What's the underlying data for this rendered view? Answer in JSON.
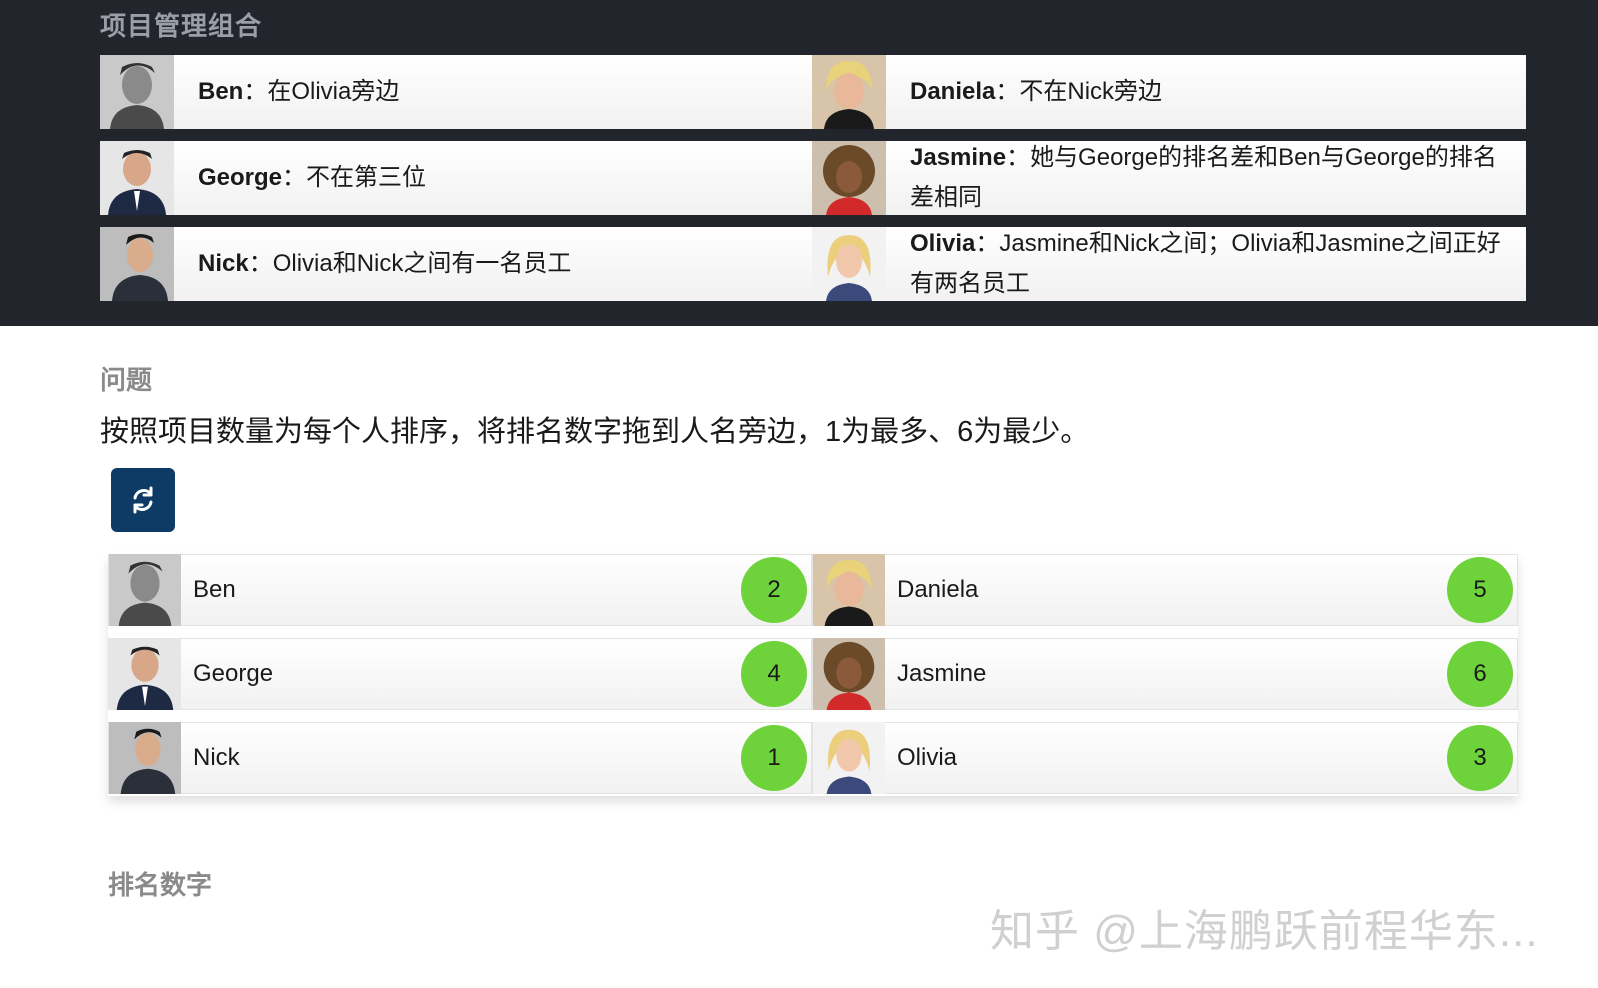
{
  "header": {
    "title": "项目管理组合"
  },
  "colors": {
    "dark_band": "#22252b",
    "badge": "#6ed33a",
    "reset_button": "#0e3b66"
  },
  "clues": [
    {
      "name": "Ben",
      "sep": "：",
      "text": "在Olivia旁边",
      "avatar_icon": "person-photo"
    },
    {
      "name": "Daniela",
      "sep": "：",
      "text": "不在Nick旁边",
      "avatar_icon": "person-photo"
    },
    {
      "name": "George",
      "sep": "：",
      "text": "不在第三位",
      "avatar_icon": "person-photo"
    },
    {
      "name": "Jasmine",
      "sep": "：",
      "text": "她与George的排名差和Ben与George的排名差相同",
      "avatar_icon": "person-photo"
    },
    {
      "name": "Nick",
      "sep": "：",
      "text": "Olivia和Nick之间有一名员工",
      "avatar_icon": "person-photo"
    },
    {
      "name": "Olivia",
      "sep": "：",
      "text": "Jasmine和Nick之间；Olivia和Jasmine之间正好有两名员工",
      "avatar_icon": "person-photo"
    }
  ],
  "question": {
    "title": "问题",
    "text": "按照项目数量为每个人排序，将排名数字拖到人名旁边，1为最多、6为最少。",
    "reset_icon": "refresh-icon"
  },
  "answers": [
    {
      "name": "Ben",
      "rank": "2"
    },
    {
      "name": "Daniela",
      "rank": "5"
    },
    {
      "name": "George",
      "rank": "4"
    },
    {
      "name": "Jasmine",
      "rank": "6"
    },
    {
      "name": "Nick",
      "rank": "1"
    },
    {
      "name": "Olivia",
      "rank": "3"
    }
  ],
  "numbers_section": {
    "title": "排名数字"
  },
  "watermark": "知乎 @上海鹏跃前程华东..."
}
